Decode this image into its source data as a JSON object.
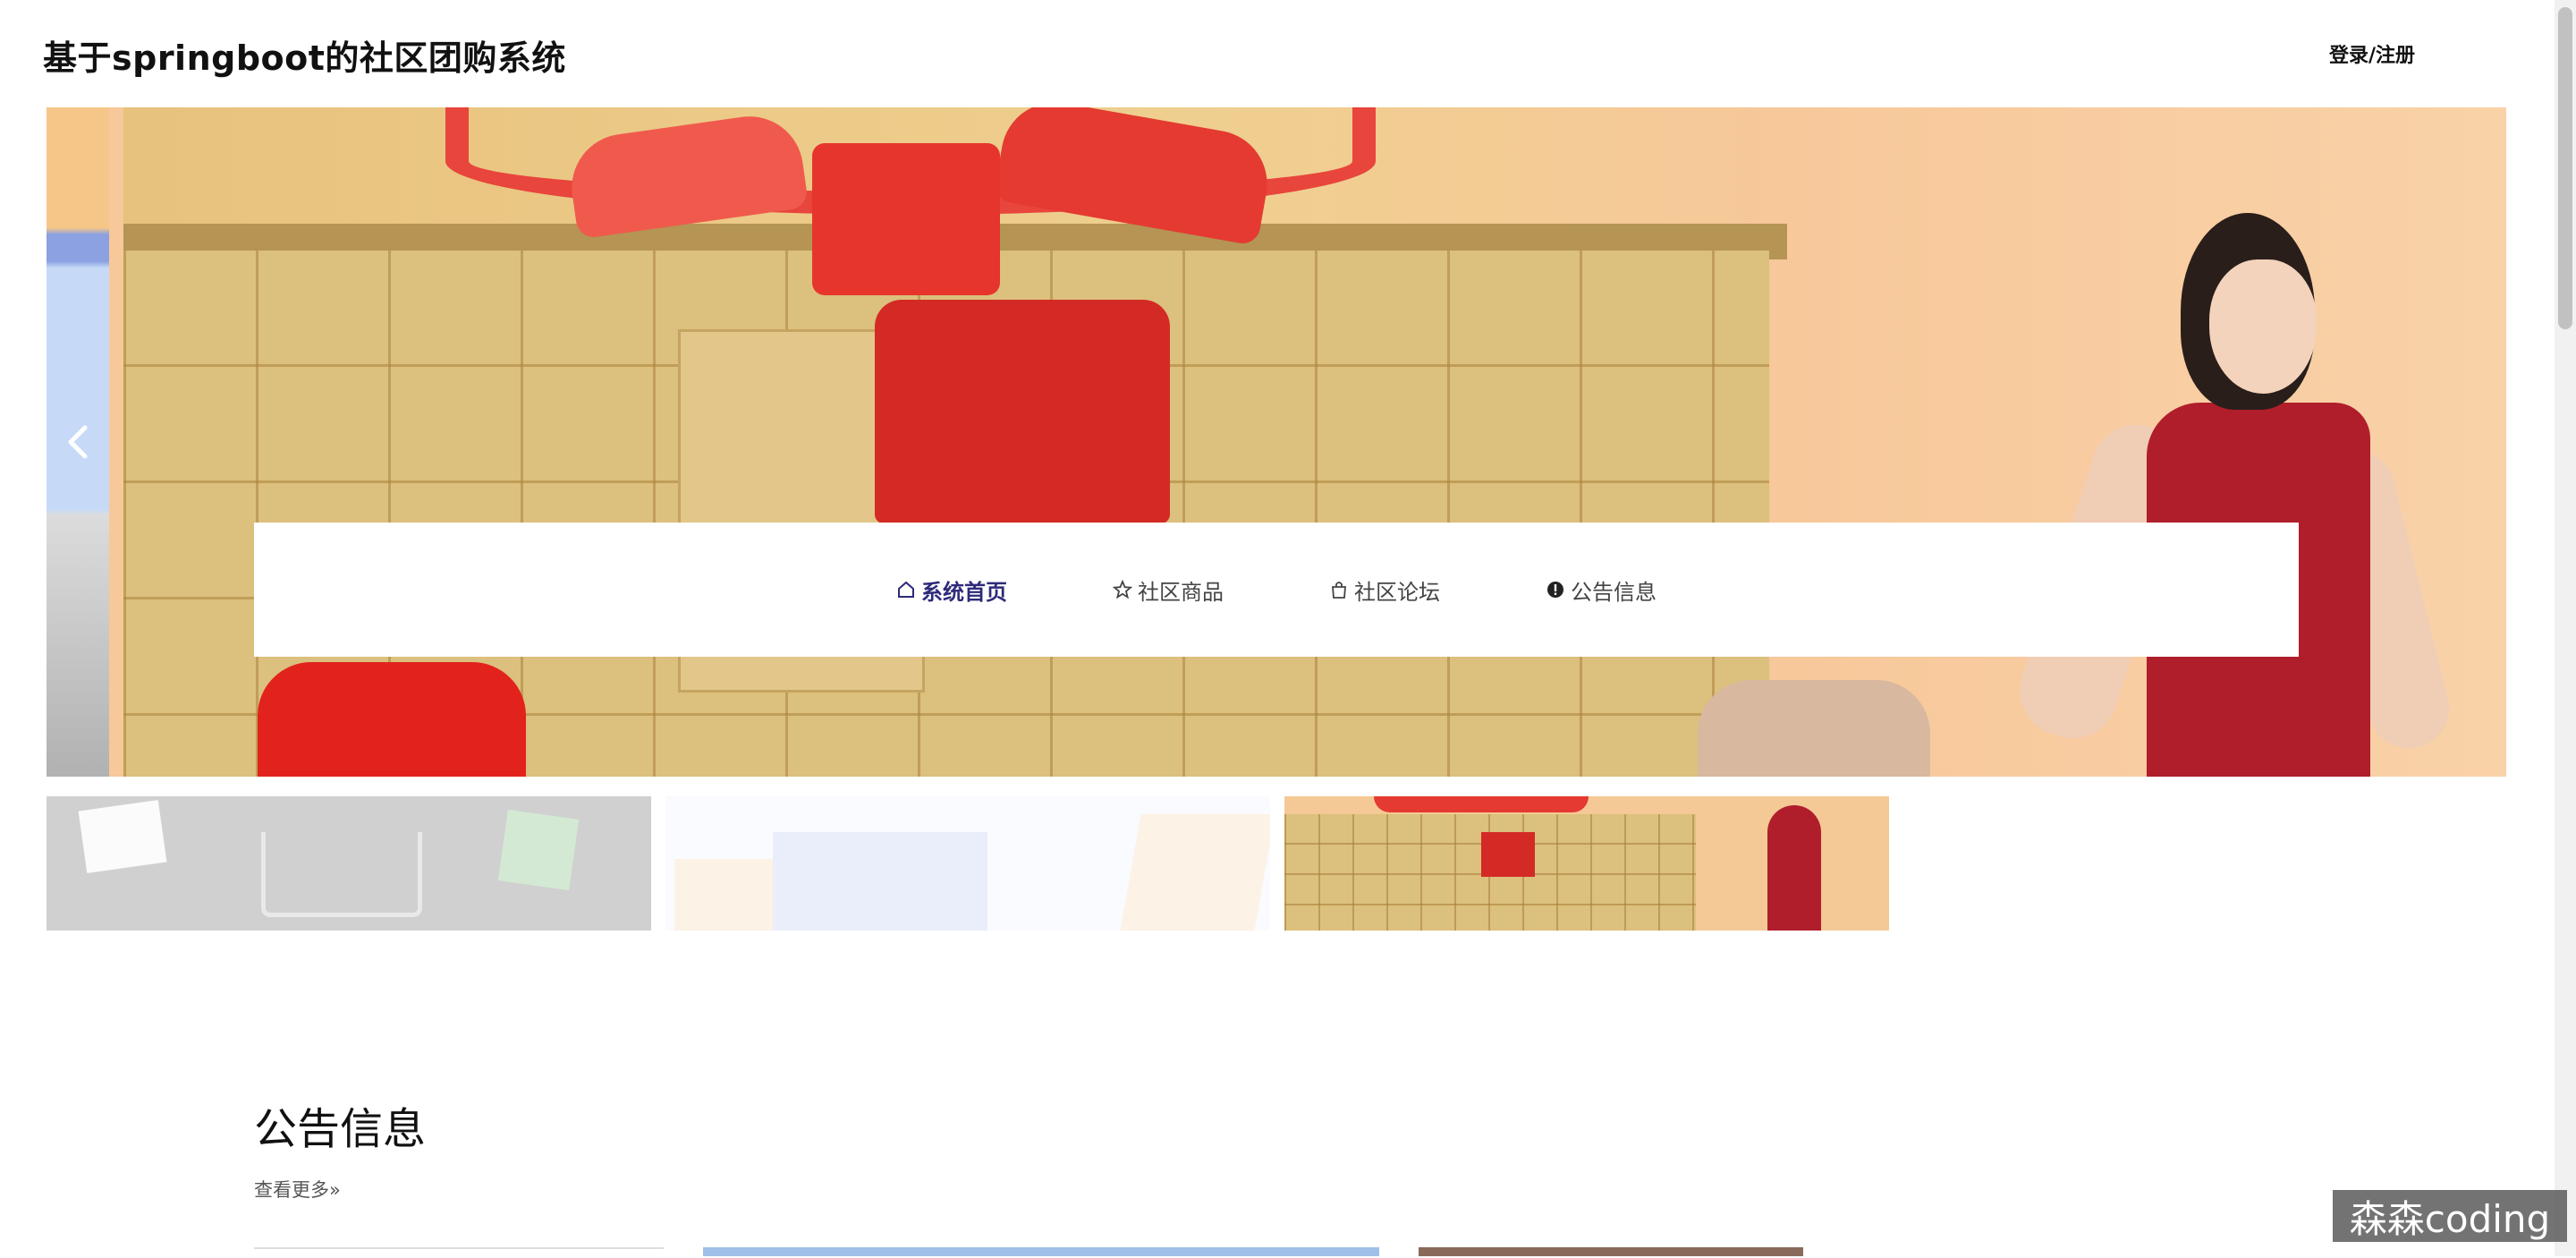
{
  "header": {
    "site_title": "基于springboot的社区团购系统",
    "login_label": "登录/注册"
  },
  "nav": {
    "items": [
      {
        "label": "系统首页",
        "icon": "home-icon",
        "active": true
      },
      {
        "label": "社区商品",
        "icon": "star-icon",
        "active": false
      },
      {
        "label": "社区论坛",
        "icon": "bag-icon",
        "active": false
      },
      {
        "label": "公告信息",
        "icon": "info-icon",
        "active": false
      }
    ]
  },
  "carousel": {
    "thumbnail_count": 3,
    "active_thumbnail": 3
  },
  "notice_section": {
    "title": "公告信息",
    "more_label": "查看更多»"
  },
  "overlay": {
    "watermark": "森森coding"
  },
  "colors": {
    "nav_active": "#2e2a7a",
    "nav_text": "#444444"
  }
}
